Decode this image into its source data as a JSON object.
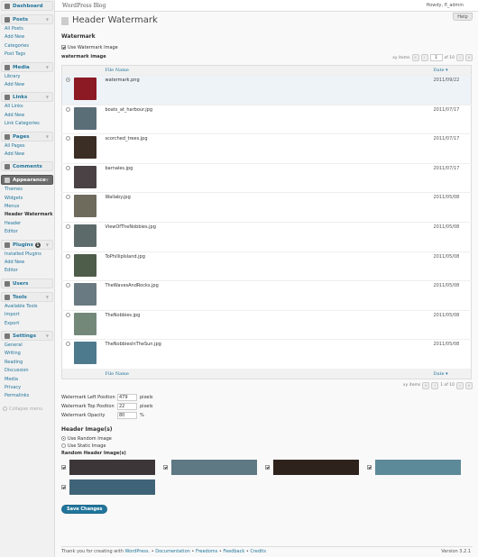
{
  "adminbar": {
    "site": "WordPress Blog",
    "howdy": "Howdy, fl_admin"
  },
  "menu": [
    {
      "label": "Dashboard",
      "icon": "dashboard-icon",
      "items": []
    },
    {
      "label": "Posts",
      "icon": "posts-icon",
      "items": [
        "All Posts",
        "Add New",
        "Categories",
        "Post Tags"
      ]
    },
    {
      "label": "Media",
      "icon": "media-icon",
      "items": [
        "Library",
        "Add New"
      ]
    },
    {
      "label": "Links",
      "icon": "links-icon",
      "items": [
        "All Links",
        "Add New",
        "Link Categories"
      ]
    },
    {
      "label": "Pages",
      "icon": "pages-icon",
      "items": [
        "All Pages",
        "Add New"
      ]
    },
    {
      "label": "Comments",
      "icon": "comments-icon",
      "items": []
    },
    {
      "label": "Appearance",
      "icon": "appearance-icon",
      "items": [
        "Themes",
        "Widgets",
        "Menus",
        "Header Watermark",
        "Header",
        "Editor"
      ]
    },
    {
      "label": "Plugins",
      "icon": "plugins-icon",
      "badge": "1",
      "items": [
        "Installed Plugins",
        "Add New",
        "Editor"
      ]
    },
    {
      "label": "Users",
      "icon": "users-icon",
      "items": []
    },
    {
      "label": "Tools",
      "icon": "tools-icon",
      "items": [
        "Available Tools",
        "Import",
        "Export"
      ]
    },
    {
      "label": "Settings",
      "icon": "settings-icon",
      "items": [
        "General",
        "Writing",
        "Reading",
        "Discussion",
        "Media",
        "Privacy",
        "Permalinks"
      ]
    }
  ],
  "collapse": "Collapse menu",
  "help": "Help",
  "page": {
    "title": "Header Watermark",
    "section": "Watermark",
    "use_watermark": "Use Watermark Image",
    "watermark_label": "watermark image",
    "pager_top": {
      "items": "xy items",
      "current": "1",
      "of": "of 10"
    },
    "pager_bottom": {
      "items": "xy items",
      "current": "1 of 10"
    },
    "col_file": "File Name",
    "col_date": "Date",
    "sort_arrow": "▾",
    "files": [
      {
        "name": "watermark.png",
        "date": "2011/09/22",
        "color": "#8c1a24",
        "selected": true
      },
      {
        "name": "boats_at_harbour.jpg",
        "date": "2011/07/17",
        "color": "#5a6e78"
      },
      {
        "name": "scorched_trees.jpg",
        "date": "2011/07/17",
        "color": "#3b2e25"
      },
      {
        "name": "barnales.jpg",
        "date": "2011/07/17",
        "color": "#4a4244"
      },
      {
        "name": "Wallaby.jpg",
        "date": "2011/05/08",
        "color": "#6e6a5c"
      },
      {
        "name": "ViewOfTheNobbies.jpg",
        "date": "2011/05/08",
        "color": "#5c6a6a"
      },
      {
        "name": "ToPhillipIsland.jpg",
        "date": "2011/05/08",
        "color": "#4e5c4a"
      },
      {
        "name": "TheWavesAndRocks.jpg",
        "date": "2011/05/08",
        "color": "#6a7a82"
      },
      {
        "name": "TheNobbies.jpg",
        "date": "2011/05/08",
        "color": "#74887a"
      },
      {
        "name": "TheNobbiesInTheSun.jpg",
        "date": "2011/05/08",
        "color": "#4e7a8e"
      }
    ],
    "left_pos_label": "Watermark Left Position",
    "left_pos": "479",
    "left_unit": "pixels",
    "top_pos_label": "Watermark Top Position",
    "top_pos": "22",
    "top_unit": "pixels",
    "opacity_label": "Watermark Opacity",
    "opacity": "80",
    "opacity_unit": "%",
    "header_images": "Header Image(s)",
    "use_random": "Use Random Image",
    "use_static": "Use Static Image",
    "random_label": "Random Header Image(s)",
    "random_images": [
      {
        "color": "#3c3638"
      },
      {
        "color": "#5e7884"
      },
      {
        "color": "#2e221c"
      },
      {
        "color": "#5d8a98"
      },
      {
        "color": "#3f6478"
      }
    ],
    "save": "Save Changes"
  },
  "footer": {
    "thanks": "Thank you for creating with",
    "wp": "WordPress.",
    "sep": "•",
    "doc": "Documentation",
    "freedoms": "Freedoms",
    "feedback": "Feedback",
    "credits": "Credits",
    "version": "Version 3.2.1"
  }
}
